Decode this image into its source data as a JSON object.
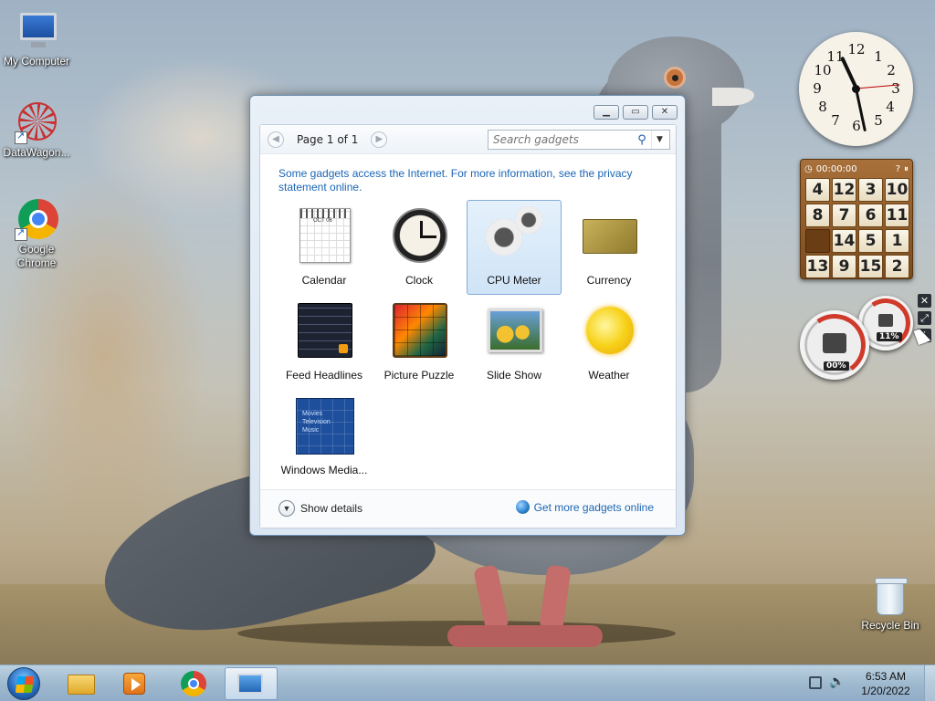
{
  "desktop": {
    "icons": [
      {
        "label": "My Computer"
      },
      {
        "label": "DataWagon..."
      },
      {
        "label": "Google Chrome"
      },
      {
        "label": "Recycle Bin"
      }
    ]
  },
  "gallery": {
    "pager": {
      "text": "Page 1 of 1"
    },
    "search": {
      "placeholder": "Search gadgets"
    },
    "info_text": "Some gadgets access the Internet.  For more information, see the privacy statement online.",
    "gadgets": [
      {
        "label": "Calendar",
        "selected": false,
        "icon": "calendar-icon"
      },
      {
        "label": "Clock",
        "selected": false,
        "icon": "clock-icon"
      },
      {
        "label": "CPU Meter",
        "selected": true,
        "icon": "cpu-meter-icon"
      },
      {
        "label": "Currency",
        "selected": false,
        "icon": "currency-icon"
      },
      {
        "label": "Feed Headlines",
        "selected": false,
        "icon": "feed-headlines-icon"
      },
      {
        "label": "Picture Puzzle",
        "selected": false,
        "icon": "picture-puzzle-icon"
      },
      {
        "label": "Slide Show",
        "selected": false,
        "icon": "slide-show-icon"
      },
      {
        "label": "Weather",
        "selected": false,
        "icon": "weather-icon"
      },
      {
        "label": "Windows Media...",
        "selected": false,
        "icon": "windows-media-center-icon"
      }
    ],
    "calendar_thumb_month": "OCT 06",
    "media_thumb_lines": [
      "Movies",
      "Television",
      "Music"
    ],
    "footer": {
      "show_details": "Show details",
      "more_online": "Get more gadgets online"
    }
  },
  "desktop_gadgets": {
    "clock_numbers": [
      "12",
      "1",
      "2",
      "3",
      "4",
      "5",
      "6",
      "7",
      "8",
      "9",
      "10",
      "11"
    ],
    "puzzle": {
      "timer": "00:00:00",
      "tiles": [
        "4",
        "12",
        "3",
        "10",
        "8",
        "7",
        "6",
        "11",
        "",
        "14",
        "5",
        "1",
        "13",
        "9",
        "15",
        "2"
      ]
    },
    "cpu_meter": {
      "cpu_value": "00%",
      "memory_value": "11%"
    }
  },
  "taskbar": {
    "time": "6:53 AM",
    "date": "1/20/2022"
  }
}
